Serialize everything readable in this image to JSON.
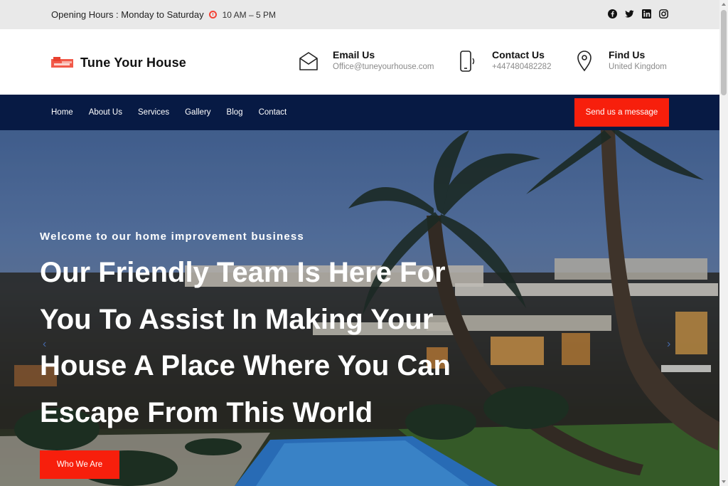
{
  "topbar": {
    "hours_label": "Opening Hours : Monday to Saturday",
    "time": "10 AM – 5 PM",
    "socials": [
      "facebook-icon",
      "twitter-icon",
      "linkedin-icon",
      "instagram-icon"
    ]
  },
  "header": {
    "site_name": "Tune Your House",
    "email": {
      "title": "Email Us",
      "value": "Office@tuneyourhouse.com"
    },
    "contact": {
      "title": "Contact Us",
      "value": "+447480482282"
    },
    "find": {
      "title": "Find Us",
      "value": "United Kingdom"
    }
  },
  "nav": {
    "items": [
      "Home",
      "About Us",
      "Services",
      "Gallery",
      "Blog",
      "Contact"
    ],
    "cta": "Send us a message"
  },
  "hero": {
    "subtitle": "Welcome to our home improvement business",
    "headline": "Our Friendly Team Is Here For You To Assist In Making Your House A Place Where You Can Escape From This World",
    "button": "Who We Are"
  },
  "colors": {
    "accent": "#f71f0c",
    "nav_bg": "#071a44",
    "topbar_bg": "#e9e9e9"
  }
}
